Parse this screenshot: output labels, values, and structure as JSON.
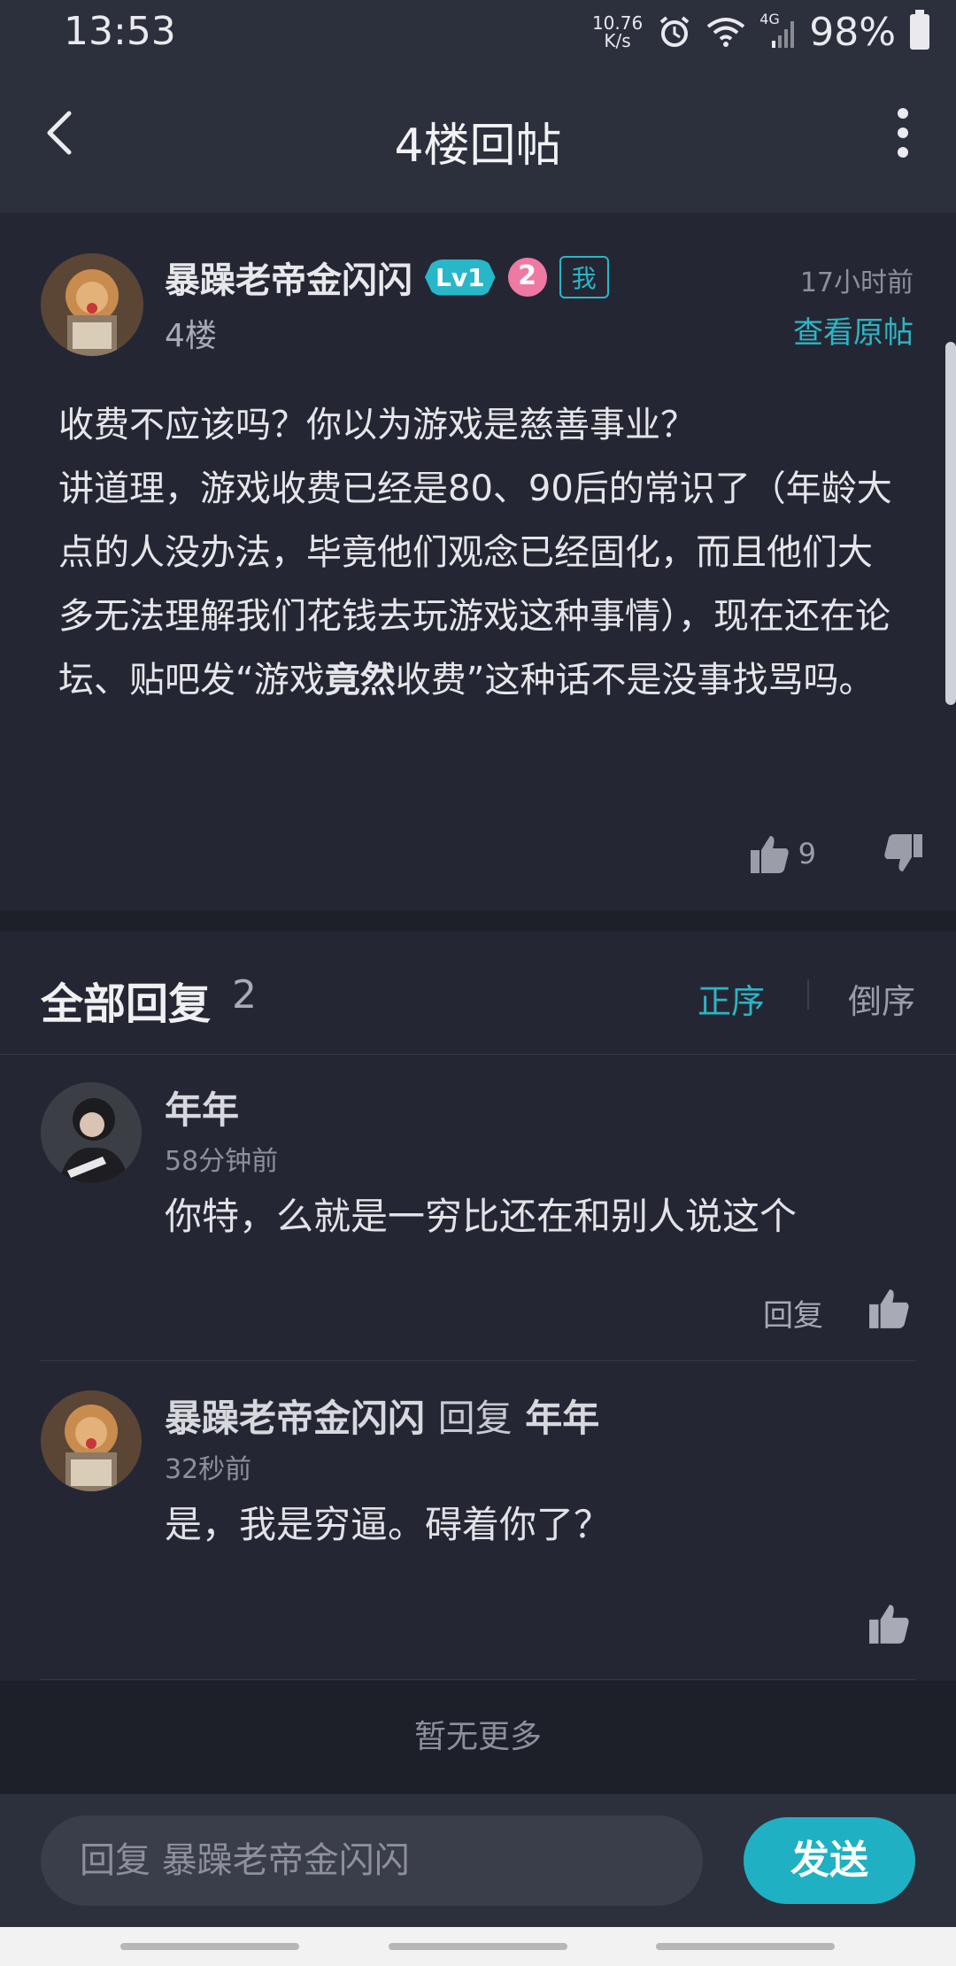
{
  "status_bar": {
    "time": "13:53",
    "net_speed_top": "10.76",
    "net_speed_bottom": "K/s",
    "network": "4G",
    "battery": "98%"
  },
  "header": {
    "title": "4楼回帖",
    "back_icon": "chevron-left-icon",
    "more_icon": "more-vertical-icon"
  },
  "post": {
    "author": "暴躁老帝金闪闪",
    "level": "Lv1",
    "badge_number": "2",
    "me_tag": "我",
    "floor": "4楼",
    "time": "17小时前",
    "view_original": "查看原帖",
    "content_line1": "收费不应该吗？你以为游戏是慈善事业？",
    "content_line2_pre": "讲道理，游戏收费已经是80、90后的常识了（年龄大点的人没办法，毕竟他们观念已经固化，而且他们大多无法理解我们花钱去玩游戏这种事情），现在还在论坛、贴吧发“游戏",
    "content_bold": "竟然",
    "content_line2_post": "收费”这种话不是没事找骂吗。",
    "likes": "9"
  },
  "replies_section": {
    "label": "全部回复",
    "count": "2",
    "sort_asc": "正序",
    "sort_desc": "倒序"
  },
  "replies": [
    {
      "name": "年年",
      "time": "58分钟前",
      "text": "你特，么就是一穷比还在和别人说这个",
      "reply_label": "回复"
    },
    {
      "name": "暴躁老帝金闪闪",
      "reply_word": "回复",
      "reply_to": "年年",
      "time": "32秒前",
      "text": "是，我是穷逼。碍着你了？"
    }
  ],
  "no_more": "暂无更多",
  "input": {
    "placeholder": "回复 暴躁老帝金闪闪",
    "send": "发送"
  },
  "colors": {
    "accent": "#1fb1c3",
    "background": "#242733",
    "header": "#2c303d"
  }
}
